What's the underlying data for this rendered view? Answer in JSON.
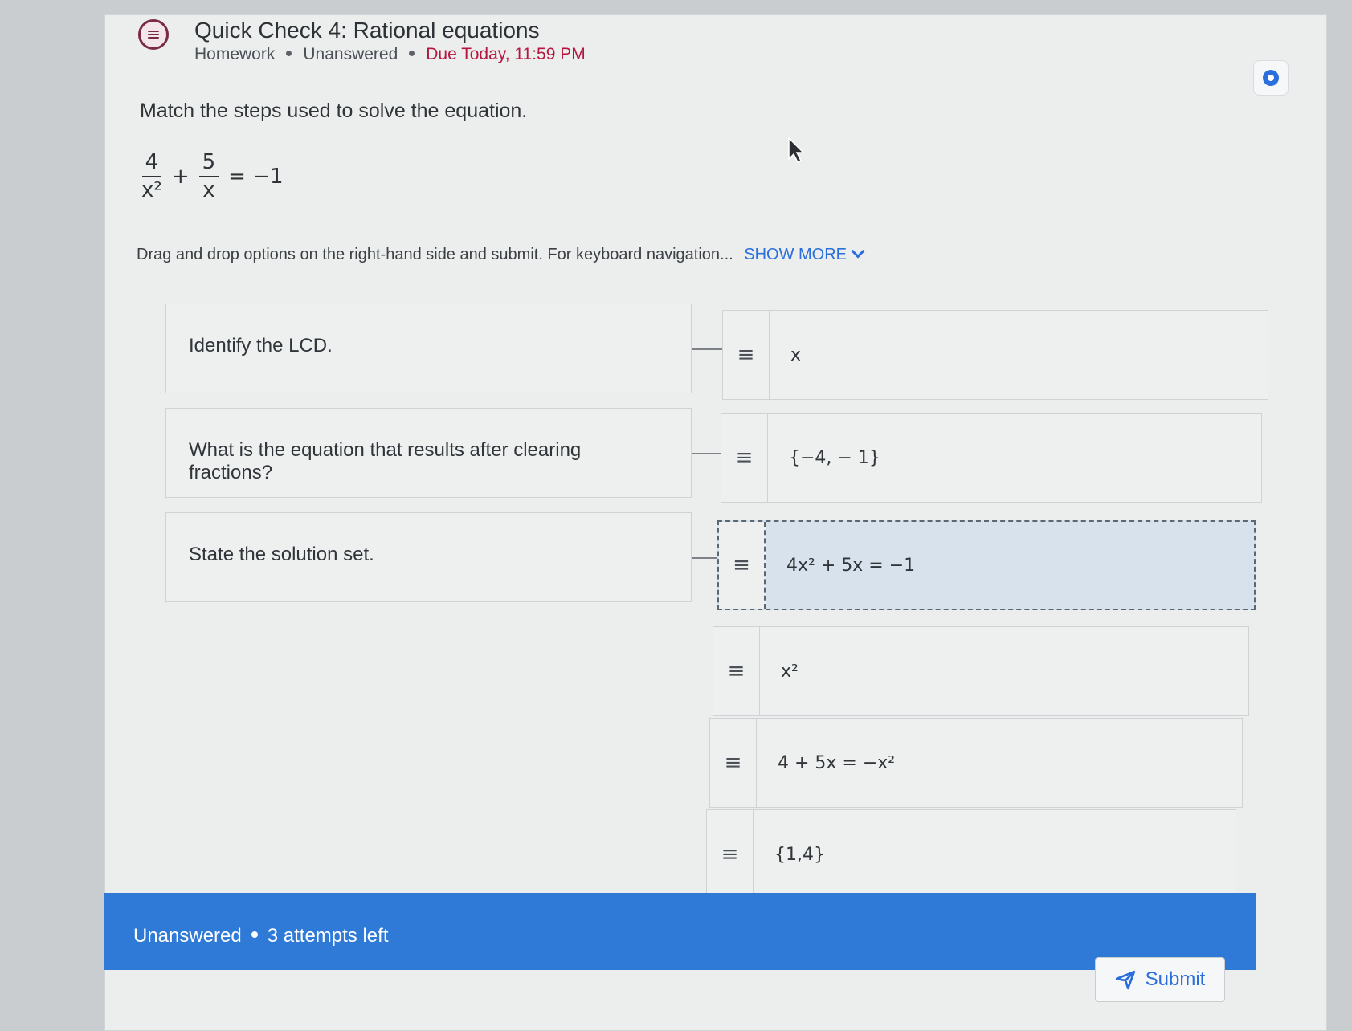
{
  "header": {
    "title": "Quick Check 4: Rational equations",
    "meta_type": "Homework",
    "meta_status": "Unanswered",
    "meta_due": "Due Today, 11:59 PM"
  },
  "question": {
    "instruction": "Match the steps used to solve the equation.",
    "equation": {
      "frac1_num": "4",
      "frac1_den": "x²",
      "plus": "+",
      "frac2_num": "5",
      "frac2_den": "x",
      "rhs": "= −1"
    },
    "help_text": "Drag and drop options on the right-hand side and submit. For keyboard navigation...",
    "show_more": "SHOW MORE"
  },
  "prompts": [
    "Identify the LCD.",
    "What is the equation that results after clearing fractions?",
    "State the solution set."
  ],
  "answers": [
    "x",
    "{−4, − 1}",
    "4x² + 5x = −1",
    "x²",
    "4 + 5x = −x²",
    "{1,4}"
  ],
  "grip_glyph": "≡",
  "footer": {
    "status": "Unanswered",
    "attempts": "3 attempts left",
    "submit_label": "Submit"
  },
  "colors": {
    "accent": "#2f7ad6",
    "due": "#b5163f",
    "header_icon": "#7a2946"
  }
}
